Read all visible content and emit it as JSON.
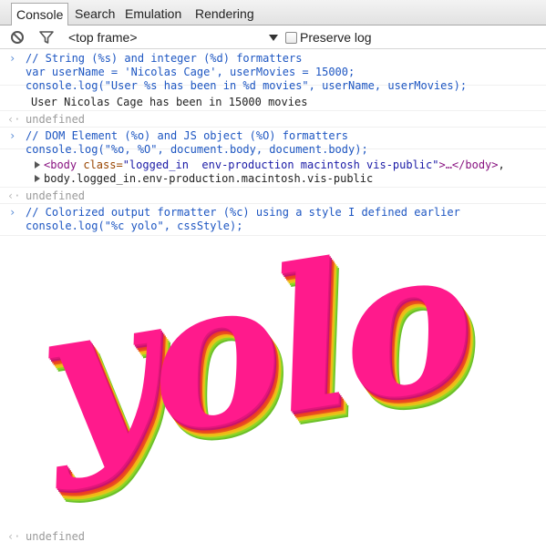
{
  "tabs": [
    {
      "label": "Console",
      "active": true
    },
    {
      "label": "Search",
      "active": false
    },
    {
      "label": "Emulation",
      "active": false
    },
    {
      "label": "Rendering",
      "active": false
    }
  ],
  "toolbar": {
    "clear_icon": "block-icon",
    "filter_icon": "filter-icon",
    "frame_select": "<top frame>",
    "preserve_log_label": "Preserve log",
    "preserve_log_checked": false
  },
  "console": {
    "prompt_glyph": "›",
    "result_glyph": "‹·",
    "block1": {
      "lines": [
        "// String (%s) and integer (%d) formatters",
        "var userName = 'Nicolas Cage', userMovies = 15000;",
        "console.log(\"User %s has been in %d movies\", userName, userMovies);"
      ],
      "output": "User Nicolas Cage has been in 15000 movies",
      "result": "undefined"
    },
    "block2": {
      "lines": [
        "// DOM Element (%o) and JS object (%O) formatters",
        "console.log(\"%o, %O\", document.body, document.body);"
      ],
      "output_tag_open": "<body",
      "output_attr_name": " class=",
      "output_attr_value": "\"logged_in  env-production macintosh vis-public\"",
      "output_tag_close": ">…</body>",
      "output_tail": ",",
      "output2": "body.logged_in.env-production.macintosh.vis-public",
      "result": "undefined"
    },
    "block3": {
      "lines": [
        "// Colorized output formatter (%c) using a style I defined earlier",
        "console.log(\"%c yolo\", cssStyle);"
      ],
      "output": "yolo",
      "result": "undefined"
    }
  },
  "colors": {
    "yolo_pink": "#ff1a8c",
    "code_blue": "#1d56c2",
    "undefined_gray": "#9a9a9a"
  }
}
